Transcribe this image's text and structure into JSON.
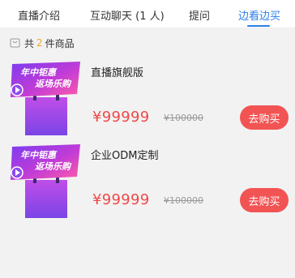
{
  "tabs": [
    {
      "label": "直播介绍"
    },
    {
      "label": "互动聊天 (1 人)"
    },
    {
      "label": "提问"
    },
    {
      "label": "边看边买"
    }
  ],
  "summary": {
    "prefix": "共",
    "count": "2",
    "suffix": "件商品"
  },
  "products": [
    {
      "name": "直播旗舰版",
      "price": "¥99999",
      "old_price": "¥100000",
      "buy_label": "去购买",
      "thumb_text_line1": "年中钜惠",
      "thumb_text_line2": "返场乐购"
    },
    {
      "name": "企业ODM定制",
      "price": "¥99999",
      "old_price": "¥100000",
      "buy_label": "去购买",
      "thumb_text_line1": "年中钜惠",
      "thumb_text_line2": "返场乐购"
    }
  ],
  "colors": {
    "accent": "#2a7ee8",
    "price": "#f04848",
    "buy_button": "#f25454",
    "summary_count": "#f5a623"
  }
}
